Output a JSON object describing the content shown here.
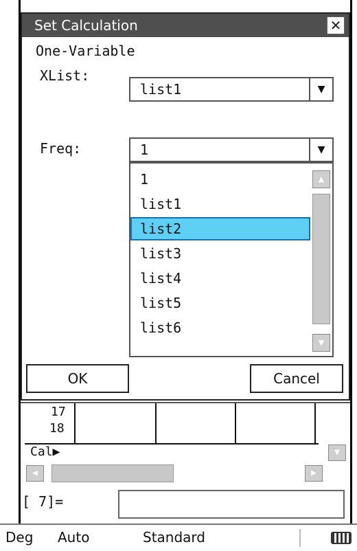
{
  "dialog": {
    "title": "Set Calculation",
    "close_glyph": "✕",
    "subtitle": "One-Variable",
    "xlist_label": "XList:",
    "xlist_value": "list1",
    "freq_label": "Freq:",
    "freq_value": "1",
    "dropdown_arrow": "▼",
    "dropdown_options": [
      "1",
      "list1",
      "list2",
      "list3",
      "list4",
      "list5",
      "list6"
    ],
    "selected_option": "list2",
    "ok_label": "OK",
    "cancel_label": "Cancel"
  },
  "spreadsheet": {
    "row_labels": [
      "17",
      "18"
    ],
    "cal_label": "Cal▶"
  },
  "scroll": {
    "up": "▲",
    "down": "▼",
    "left": "◀",
    "right": "▶"
  },
  "entry": {
    "prefix": "[  7]="
  },
  "statusbar": {
    "angle": "Deg",
    "mode": "Auto",
    "display": "Standard"
  },
  "icons": [
    "close-icon",
    "dropdown-arrow-icon",
    "scroll-up-icon",
    "scroll-down-icon",
    "scroll-left-icon",
    "scroll-right-icon",
    "battery-icon"
  ]
}
